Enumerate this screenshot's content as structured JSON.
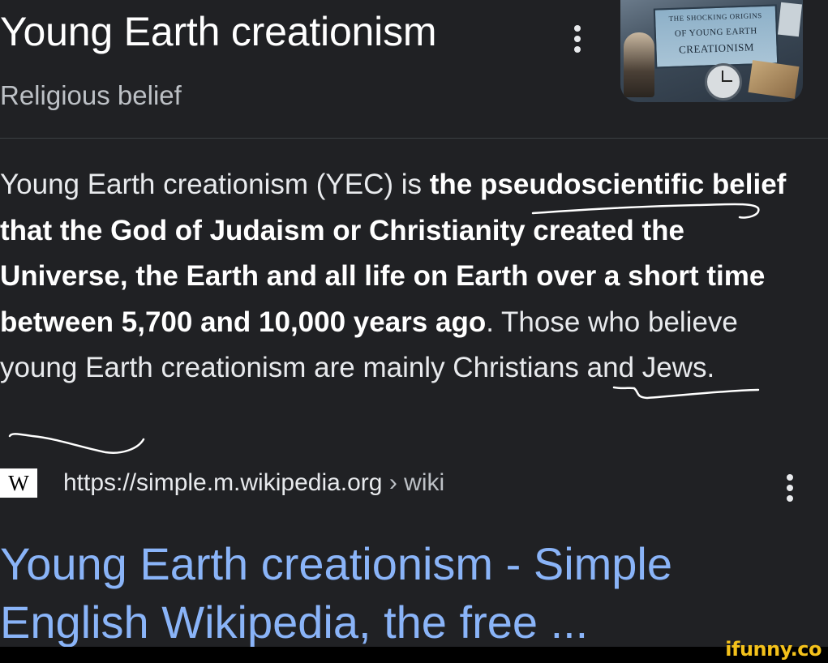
{
  "panel": {
    "title": "Young Earth creationism",
    "subtitle": "Religious belief",
    "thumbnail_text": {
      "line1": "THE SHOCKING ORIGINS",
      "line2": "OF YOUNG EARTH",
      "line3": "CREATIONISM"
    }
  },
  "snippet": {
    "lead": "Young Earth creationism (YEC) is ",
    "bold": "the pseudoscientific belief that the God of Judaism or Christianity created the Universe, the Earth and all life on Earth over a short time between 5,700 and 10,000 years ago",
    "tail": ". Those who believe young Earth creationism are mainly Christians and Jews."
  },
  "source": {
    "favicon_letter": "W",
    "url": "https://simple.m.wikipedia.org",
    "path": " › wiki"
  },
  "result": {
    "title": "Young Earth creationism - Simple English Wikipedia, the free ..."
  },
  "watermark": "ifunny.co",
  "colors": {
    "background": "#202124",
    "link": "#8ab4f8",
    "text": "#e8eaed",
    "muted": "#bdc1c6",
    "watermark": "#f3c11b"
  },
  "icons": {
    "menu": "kebab-vertical-icon",
    "favicon": "wikipedia-icon"
  }
}
